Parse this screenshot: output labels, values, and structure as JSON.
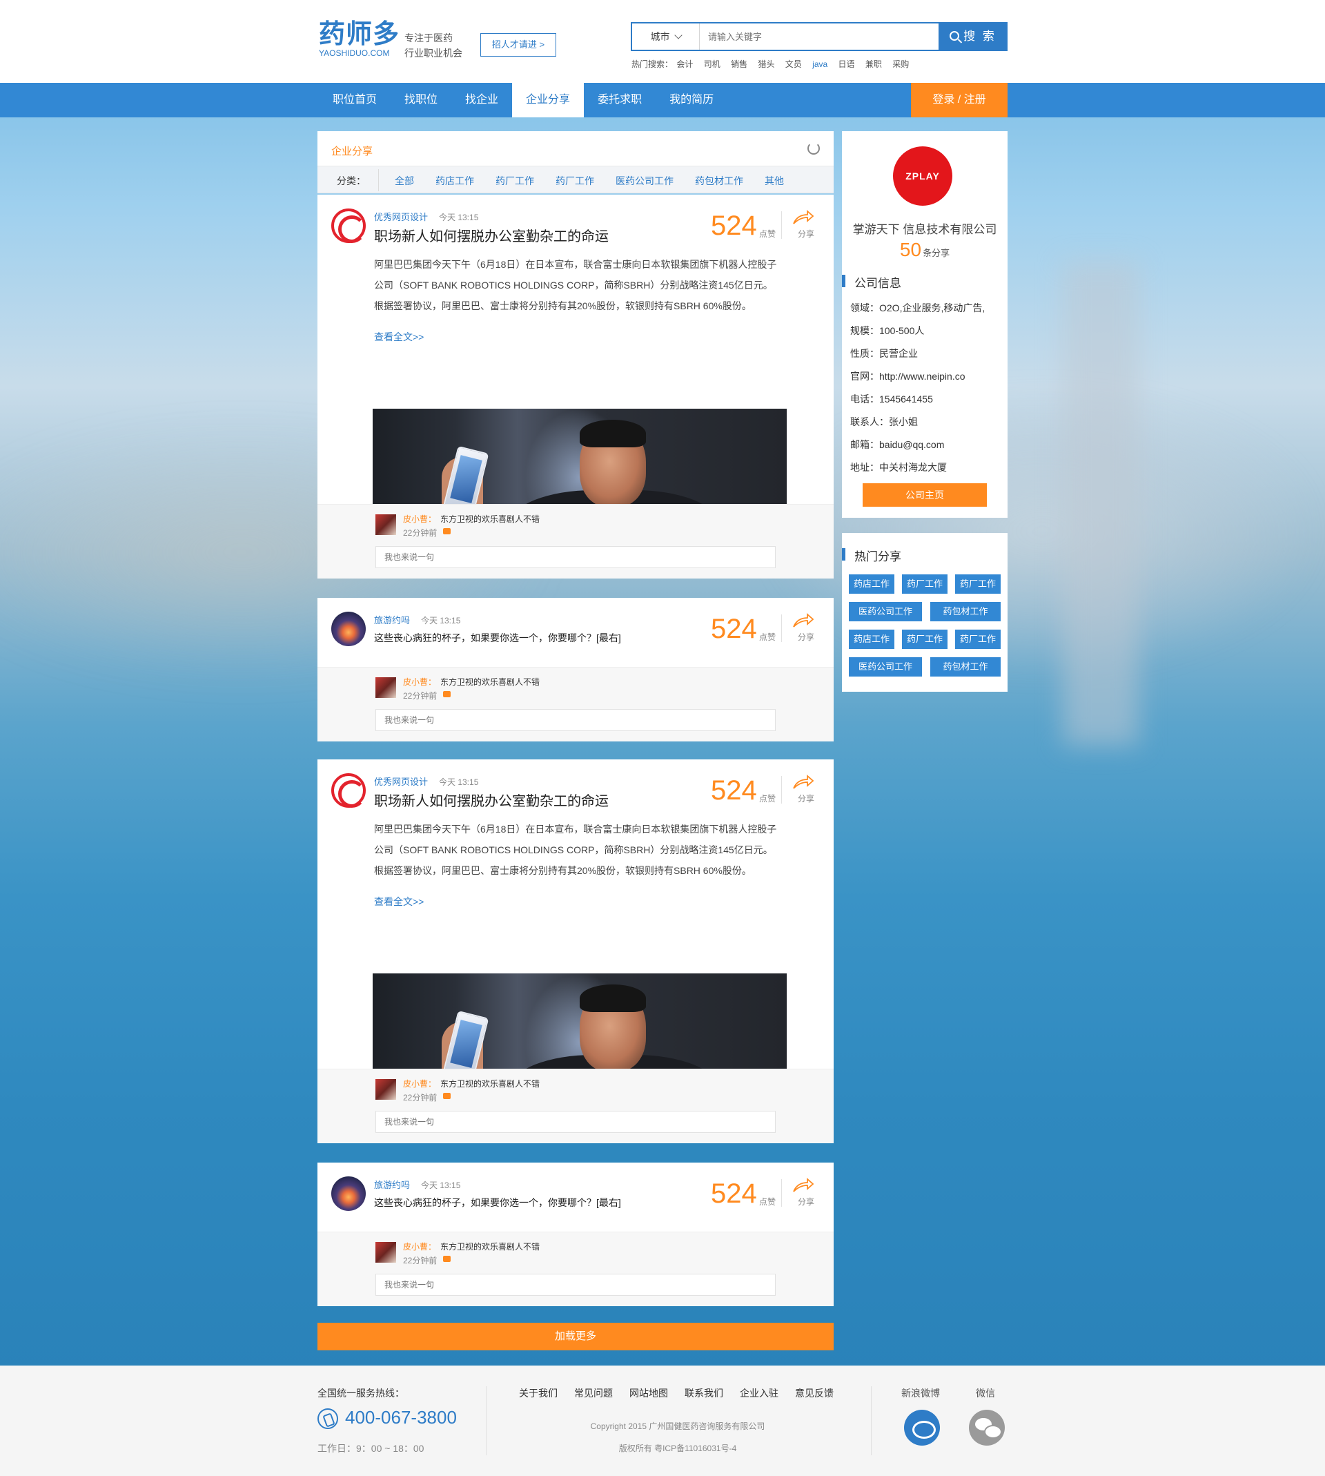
{
  "brand": {
    "name_cn": "药师多",
    "name_en": "YAOSHIDUO.COM",
    "slogan_line1": "专注于医药",
    "slogan_line2": "行业职业机会"
  },
  "header": {
    "recruit_button": "招人才请进 >",
    "city": "城市",
    "search_placeholder": "请输入关键字",
    "search_button": "搜 索",
    "hot_label": "热门搜索：",
    "hot_terms": [
      "会计",
      "司机",
      "销售",
      "猎头",
      "文员",
      "java",
      "日语",
      "兼职",
      "采购"
    ]
  },
  "nav": {
    "items": [
      "职位首页",
      "找职位",
      "找企业",
      "企业分享",
      "委托求职",
      "我的简历"
    ],
    "active_index": 3,
    "login": "登录 / 注册"
  },
  "feed": {
    "title": "企业分享",
    "category_label": "分类：",
    "categories": [
      "全部",
      "药店工作",
      "药厂工作",
      "药厂工作",
      "医药公司工作",
      "药包材工作",
      "其他"
    ],
    "like_label": "点赞",
    "share_label": "分享",
    "read_more": "查看全文>>",
    "comment_placeholder": "我也来说一句",
    "posts": [
      {
        "author": "优秀网页设计",
        "time": "今天 13:15",
        "title": "职场新人如何摆脱办公室勤杂工的命运",
        "likes": "524",
        "body": "阿里巴巴集团今天下午（6月18日）在日本宣布，联合富士康向日本软银集团旗下机器人控股子公司（SOFT BANK ROBOTICS HOLDINGS CORP，简称SBRH）分别战略注资145亿日元。根据签署协议，阿里巴巴、富士康将分别持有其20%股份，软银则持有SBRH 60%股份。",
        "comment": {
          "name": "皮小曹：",
          "text": "东方卫视的欢乐喜剧人不错",
          "time": "22分钟前"
        }
      },
      {
        "author": "旅游约吗",
        "time": "今天 13:15",
        "title": "这些丧心病狂的杯子，如果要你选一个，你要哪个？[最右]",
        "likes": "524",
        "comment": {
          "name": "皮小曹：",
          "text": "东方卫视的欢乐喜剧人不错",
          "time": "22分钟前"
        }
      },
      {
        "author": "优秀网页设计",
        "time": "今天 13:15",
        "title": "职场新人如何摆脱办公室勤杂工的命运",
        "likes": "524",
        "body": "阿里巴巴集团今天下午（6月18日）在日本宣布，联合富士康向日本软银集团旗下机器人控股子公司（SOFT BANK ROBOTICS HOLDINGS CORP，简称SBRH）分别战略注资145亿日元。根据签署协议，阿里巴巴、富士康将分别持有其20%股份，软银则持有SBRH 60%股份。",
        "comment": {
          "name": "皮小曹：",
          "text": "东方卫视的欢乐喜剧人不错",
          "time": "22分钟前"
        }
      },
      {
        "author": "旅游约吗",
        "time": "今天 13:15",
        "title": "这些丧心病狂的杯子，如果要你选一个，你要哪个？[最右]",
        "likes": "524",
        "comment": {
          "name": "皮小曹：",
          "text": "东方卫视的欢乐喜剧人不错",
          "time": "22分钟前"
        }
      }
    ],
    "load_more": "加载更多"
  },
  "company": {
    "logo_text": "ZPLAY",
    "name": "掌游天下 信息技术有限公司",
    "share_count": "50",
    "share_count_label": "条分享",
    "section_title": "公司信息",
    "info": [
      "领域：O2O,企业服务,移动广告,",
      "规模：100-500人",
      "性质：民营企业",
      "官网：http://www.neipin.co",
      "电话：1545641455",
      "联系人：张小姐",
      "邮箱：baidu@qq.com",
      "地址：中关村海龙大厦"
    ],
    "home_button": "公司主页"
  },
  "hot_share": {
    "title": "热门分享",
    "tags": [
      "药店工作",
      "药厂工作",
      "药厂工作",
      "医药公司工作",
      "药包材工作",
      "药店工作",
      "药厂工作",
      "药厂工作",
      "医药公司工作",
      "药包材工作"
    ]
  },
  "footer": {
    "hotline_label": "全国统一服务热线：",
    "phone": "400-067-3800",
    "hours": "工作日：9：00 ~ 18：00",
    "links": [
      "关于我们",
      "常见问题",
      "网站地图",
      "联系我们",
      "企业入驻",
      "意见反馈"
    ],
    "copyright": "Copyright 2015 广州国健医药咨询服务有限公司",
    "icp": "版权所有    粤ICP备11016031号-4",
    "weibo_label": "新浪微博",
    "wechat_label": "微信"
  },
  "colors": {
    "primary": "#3288d4",
    "accent": "#ff8a1f",
    "link": "#2e7cc7"
  }
}
